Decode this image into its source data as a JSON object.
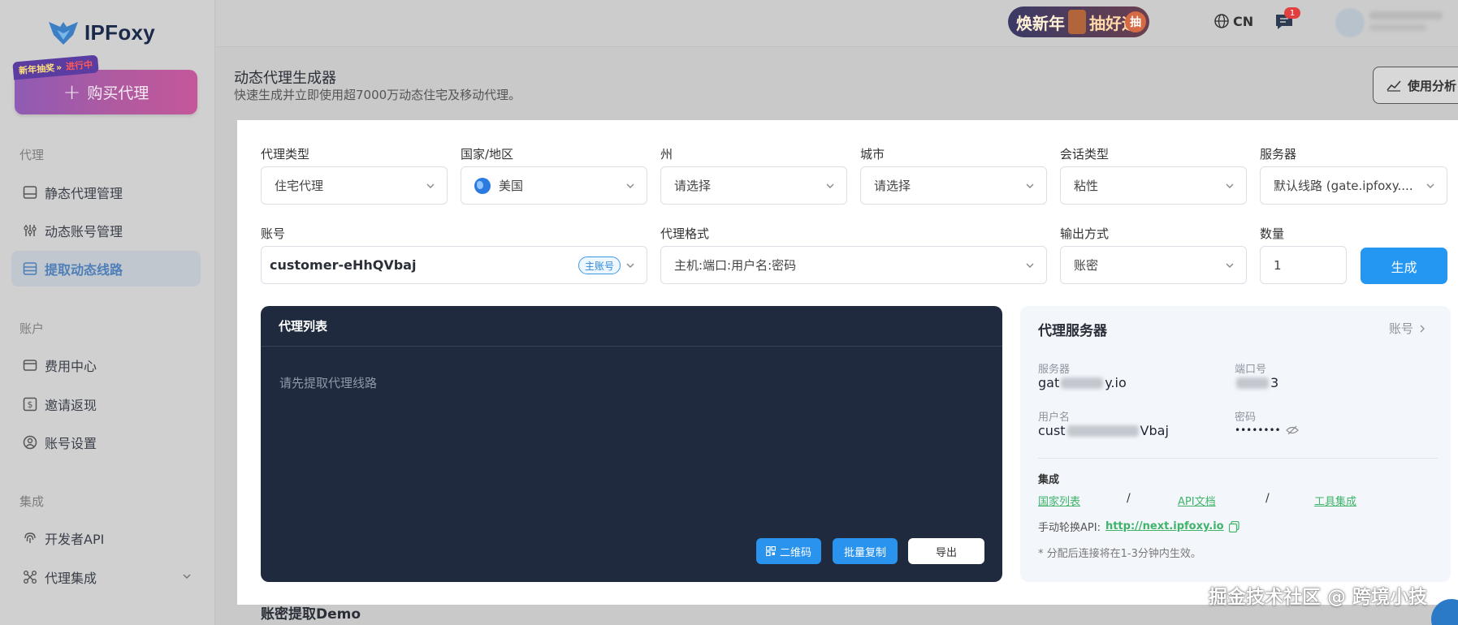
{
  "brand": {
    "name": "IPFoxy"
  },
  "sidebar": {
    "promo_tag": "新年抽奖",
    "promo_tag_hl": "进行中",
    "buy_button": "购买代理",
    "sections": [
      {
        "title": "代理",
        "items": [
          {
            "label": "静态代理管理",
            "icon": "server-icon",
            "active": false
          },
          {
            "label": "动态账号管理",
            "icon": "dynamic-icon",
            "active": false
          },
          {
            "label": "提取动态线路",
            "icon": "extract-icon",
            "active": true
          }
        ]
      },
      {
        "title": "账户",
        "items": [
          {
            "label": "费用中心",
            "icon": "wallet-icon",
            "active": false
          },
          {
            "label": "邀请返现",
            "icon": "dollar-icon",
            "active": false
          },
          {
            "label": "账号设置",
            "icon": "user-icon",
            "active": false
          }
        ]
      },
      {
        "title": "集成",
        "items": [
          {
            "label": "开发者API",
            "icon": "fingerprint-icon",
            "active": false
          },
          {
            "label": "代理集成",
            "icon": "integration-icon",
            "active": false
          }
        ]
      }
    ]
  },
  "topbar": {
    "promo_banner": {
      "text1": "焕新年",
      "text2": "抽好运",
      "circle": "抽"
    },
    "language": "CN",
    "notification_count": "1"
  },
  "page": {
    "title": "动态代理生成器",
    "subtitle": "快速生成并立即使用超7000万动态住宅及移动代理。",
    "analyze_button": "使用分析"
  },
  "form": {
    "proxy_type": {
      "label": "代理类型",
      "value": "住宅代理"
    },
    "country": {
      "label": "国家/地区",
      "value": "美国"
    },
    "state": {
      "label": "州",
      "value": "请选择"
    },
    "city": {
      "label": "城市",
      "value": "请选择"
    },
    "session": {
      "label": "会话类型",
      "value": "粘性"
    },
    "server": {
      "label": "服务器",
      "value": "默认线路 (gate.ipfoxy...."
    },
    "account": {
      "label": "账号",
      "value": "customer-eHhQVbaj",
      "tag": "主账号"
    },
    "format": {
      "label": "代理格式",
      "value": "主机:端口:用户名:密码"
    },
    "output": {
      "label": "输出方式",
      "value": "账密"
    },
    "quantity": {
      "label": "数量",
      "value": "1"
    },
    "generate_button": "生成"
  },
  "proxy_list": {
    "title": "代理列表",
    "empty_text": "请先提取代理线路",
    "qr_button": "二维码",
    "copy_button": "批量复制",
    "export_button": "导出"
  },
  "proxy_server": {
    "title": "代理服务器",
    "account_link": "账号",
    "server_label": "服务器",
    "server_prefix": "gat",
    "server_suffix": "y.io",
    "port_label": "端口号",
    "port_suffix": "3",
    "username_label": "用户名",
    "username_prefix": "cust",
    "username_suffix": "Vbaj",
    "password_label": "密码",
    "password_value": "••••••••",
    "integration_title": "集成",
    "links": [
      "国家列表",
      "API文档",
      "工具集成"
    ],
    "separator": "/",
    "api_label": "手动轮换API:",
    "api_url": "http://next.ipfoxy.io",
    "note": "* 分配后连接将在1-3分钟内生效。"
  },
  "demo_title": "账密提取Demo",
  "watermark": "掘金技术社区 @ 跨境小技",
  "colors": {
    "primary": "#2397f1",
    "dark_panel": "#1f2a3e",
    "link_green": "#3fb36a",
    "buy_gradient": "#b05aa0"
  }
}
